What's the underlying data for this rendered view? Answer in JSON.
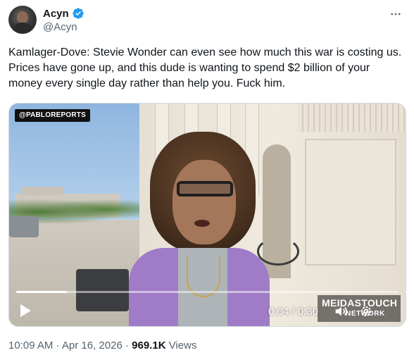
{
  "author": {
    "display_name": "Acyn",
    "handle": "@Acyn",
    "verified_icon": "verified-badge-icon",
    "avatar_icon": "avatar"
  },
  "tweet": {
    "text": "Kamlager-Dove: Stevie Wonder can even see how much this war is costing us. Prices have gone up, and this dude is wanting to spend $2 billion of your money every single day rather than help you. Fuck him."
  },
  "video": {
    "source_badge": "@PABLOREPORTS",
    "current_time": "0:04",
    "time_separator": " / ",
    "duration": "0:30",
    "progress_fraction": 0.133,
    "watermark_line1": "MEIDASTOUCH",
    "watermark_line2": "NETWORK"
  },
  "meta": {
    "time": "10:09 AM",
    "separator1": " · ",
    "date": "Apr 16, 2026",
    "separator2": " · ",
    "views_count": "969.1K",
    "views_label": " Views"
  },
  "colors": {
    "verified": "#1d9bf0",
    "text_primary": "#0f1419",
    "text_secondary": "#536471"
  }
}
